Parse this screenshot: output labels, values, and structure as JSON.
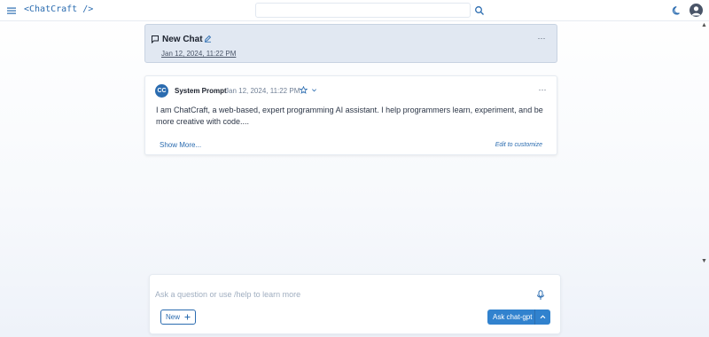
{
  "header": {
    "brand": "<ChatCraft />",
    "menu_icon": "hamburger-menu-icon",
    "search": {
      "placeholder": "",
      "value": "",
      "icon": "search-icon"
    },
    "theme_icon": "moon-icon",
    "avatar_icon": "user-avatar-icon"
  },
  "chat": {
    "title": "New Chat",
    "date": "Jan 12, 2024, 11:22 PM",
    "title_icon": "chat-bubble-icon",
    "edit_icon": "pencil-icon",
    "more_icon": "more-horizontal-icon"
  },
  "message": {
    "avatar_initials": "CC",
    "author": "System Prompt",
    "date": "Jan 12, 2024, 11:22 PM",
    "star_icon": "star-outline-icon",
    "caret_icon": "chevron-down-icon",
    "body": "I am ChatCraft, a web-based, expert programming AI assistant. I help programmers learn, experiment, and be more creative with code....",
    "show_more": "Show More...",
    "edit_hint": "Edit to customize"
  },
  "composer": {
    "placeholder": "Ask a question or use /help to learn more",
    "mic_icon": "microphone-icon",
    "new_label": "New",
    "new_icon": "plus-icon",
    "ask_label": "Ask chat-gpt",
    "ask_caret_icon": "chevron-up-icon"
  },
  "colors": {
    "accent": "#3182ce",
    "link": "#2b6cb0",
    "header_card_bg": "#e1e8f2"
  }
}
